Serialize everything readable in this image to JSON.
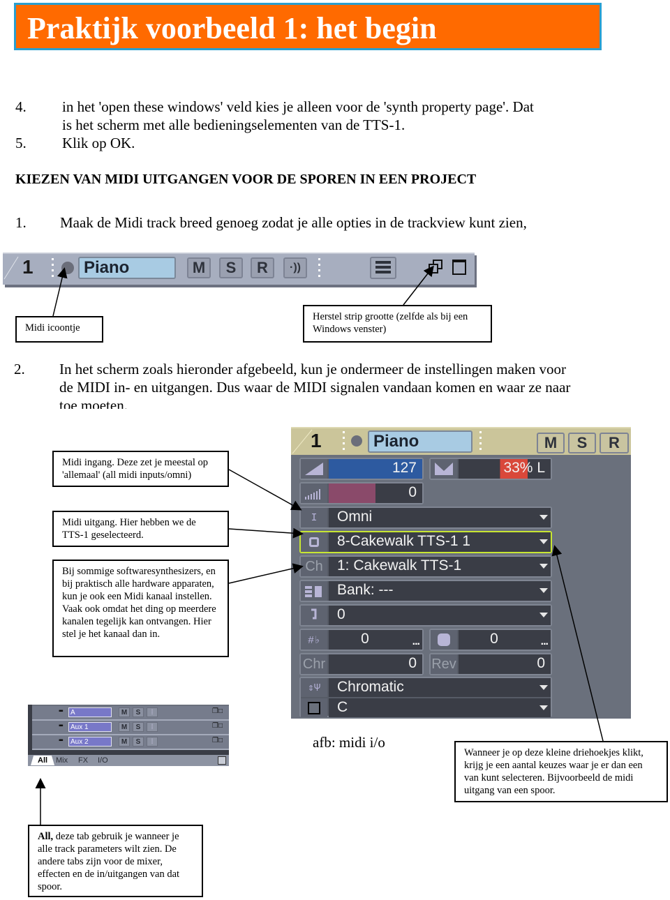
{
  "title": "Praktijk voorbeeld 1: het begin",
  "colors": {
    "banner_bg": "#ff6a00",
    "banner_border": "#2a9fd0"
  },
  "steps_top": [
    {
      "num": "4.",
      "lines": [
        "in het 'open these windows' veld kies je alleen voor de 'synth property page'. Dat",
        "is het scherm met alle bedieningselementen van de TTS-1."
      ]
    },
    {
      "num": "5.",
      "lines": [
        "Klik op OK."
      ]
    }
  ],
  "section_heading": "KIEZEN VAN MIDI UITGANGEN VOOR DE SPOREN IN EEN PROJECT",
  "step1": {
    "num": "1.",
    "text": "Maak de Midi track breed genoeg zodat je alle opties in de trackview kunt zien,"
  },
  "strip1": {
    "track_number": "1",
    "track_name": "Piano",
    "buttons": [
      "M",
      "S",
      "R"
    ],
    "input_echo_icon": "·))",
    "icons": [
      "midi-icon",
      "piano-roll-icon",
      "restore-strip-size-icon",
      "maximize-strip-icon"
    ]
  },
  "callouts_top": {
    "midi_icon": "Midi icoontje",
    "restore": "Herstel strip grootte (zelfde als bij een Windows venster)"
  },
  "step2": {
    "num": "2.",
    "lines": [
      "In het scherm zoals hieronder afgebeeld, kun je ondermeer de instellingen maken voor",
      "de MIDI in- en uitgangen. Dus waar de MIDI signalen vandaan komen en waar ze naar",
      "toe moeten."
    ]
  },
  "panel": {
    "track_number": "1",
    "track_name": "Piano",
    "buttons": [
      "M",
      "S",
      "R"
    ],
    "volume": {
      "value": "127",
      "fill_fraction": 1.0
    },
    "pan": {
      "value": "33% L"
    },
    "velocity": {
      "value": "0",
      "fill_fraction": 0.5
    },
    "input": {
      "icon_label": "I",
      "value": "Omni"
    },
    "output": {
      "value": "8-Cakewalk TTS-1 1",
      "highlight_color": "#c8e632"
    },
    "channel": {
      "icon_label": "Ch",
      "value": "1: Cakewalk TTS-1"
    },
    "bank": {
      "value": "Bank: ---"
    },
    "patch": {
      "value": "0"
    },
    "key_offset": {
      "value": "0"
    },
    "time_offset": {
      "value": "0"
    },
    "chorus": {
      "icon_label": "Chr",
      "value": "0"
    },
    "reverb": {
      "icon_label": "Rev",
      "value": "0"
    },
    "drum_map": {
      "value": "Chromatic"
    },
    "key": {
      "value": "C"
    }
  },
  "callouts_mid": {
    "midi_in": "Midi ingang. Deze zet je meestal op 'allemaal' (all midi inputs/omni)",
    "midi_out": "Midi uitgang. Hier hebben we de TTS-1 geselecteerd.",
    "channel": "Bij sommige softwaresynthesizers, en bij praktisch alle hardware apparaten, kun je ook een Midi kanaal instellen. Vaak ook omdat het ding op meerdere kanalen tegelijk kan ontvangen. Hier stel je het kanaal dan in."
  },
  "mini": {
    "tracks": [
      {
        "name": "A",
        "buttons": [
          "M",
          "S"
        ]
      },
      {
        "name": "Aux 1",
        "buttons": [
          "M",
          "S"
        ]
      },
      {
        "name": "Aux 2",
        "buttons": [
          "M",
          "S"
        ]
      }
    ],
    "tabs": [
      "All",
      "Mix",
      "FX",
      "I/O"
    ],
    "active_tab": "All"
  },
  "caption": "afb: midi i/o",
  "callouts_bottom": {
    "triangles": "Wanneer je op deze kleine driehoekjes klikt, krijg je een aantal keuzes waar je er dan een van kunt selecteren. Bijvoorbeeld de midi uitgang van een spoor.",
    "all_tab_bold": "All,",
    "all_tab_rest": " deze tab gebruik je wanneer je alle track parameters wilt zien. De andere tabs zijn voor de mixer, effecten en de in/uitgangen van dat spoor."
  }
}
